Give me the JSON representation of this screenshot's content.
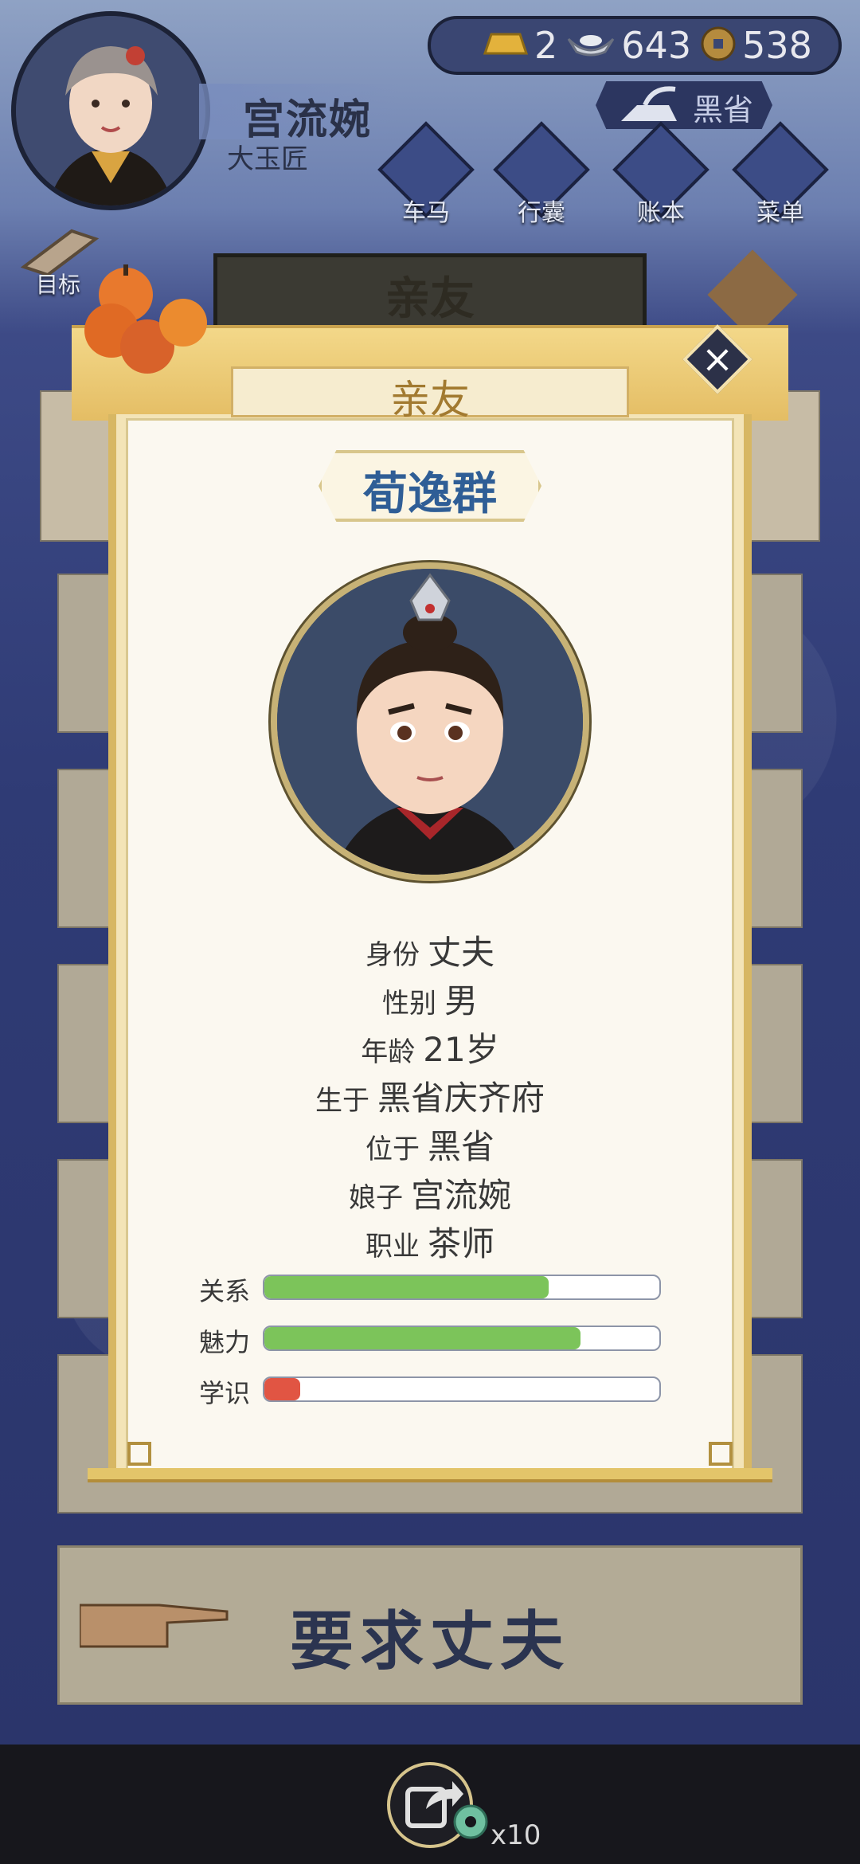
{
  "player": {
    "name": "宫流婉",
    "title": "大玉匠"
  },
  "currency": [
    {
      "icon": "gold-bar-icon",
      "value": "2"
    },
    {
      "icon": "silver-ingot-icon",
      "value": "643"
    },
    {
      "icon": "copper-coin-icon",
      "value": "538"
    }
  ],
  "location_button": "黑省",
  "nav": [
    {
      "label": "车马",
      "icon": "carriage-icon"
    },
    {
      "label": "行囊",
      "icon": "bag-icon"
    },
    {
      "label": "账本",
      "icon": "ledger-icon"
    },
    {
      "label": "菜单",
      "icon": "menu-dots-icon"
    }
  ],
  "goal_label": "目标",
  "panel_title": "亲友",
  "modal": {
    "header": "亲友",
    "name": "荀逸群",
    "info": [
      {
        "label": "身份",
        "value": "丈夫"
      },
      {
        "label": "性别",
        "value": "男"
      },
      {
        "label": "年龄",
        "value": "21岁"
      },
      {
        "label": "生于",
        "value": "黑省庆齐府"
      },
      {
        "label": "位于",
        "value": "黑省"
      },
      {
        "label": "娘子",
        "value": "宫流婉"
      },
      {
        "label": "职业",
        "value": "茶师"
      }
    ],
    "stats": [
      {
        "label": "关系",
        "fraction": 0.72,
        "color": "#7cc45a"
      },
      {
        "label": "魅力",
        "fraction": 0.8,
        "color": "#7cc45a"
      },
      {
        "label": "学识",
        "fraction": 0.09,
        "color": "#e15543"
      }
    ]
  },
  "action_button": "要求丈夫",
  "share": {
    "reward_count": "x10"
  }
}
